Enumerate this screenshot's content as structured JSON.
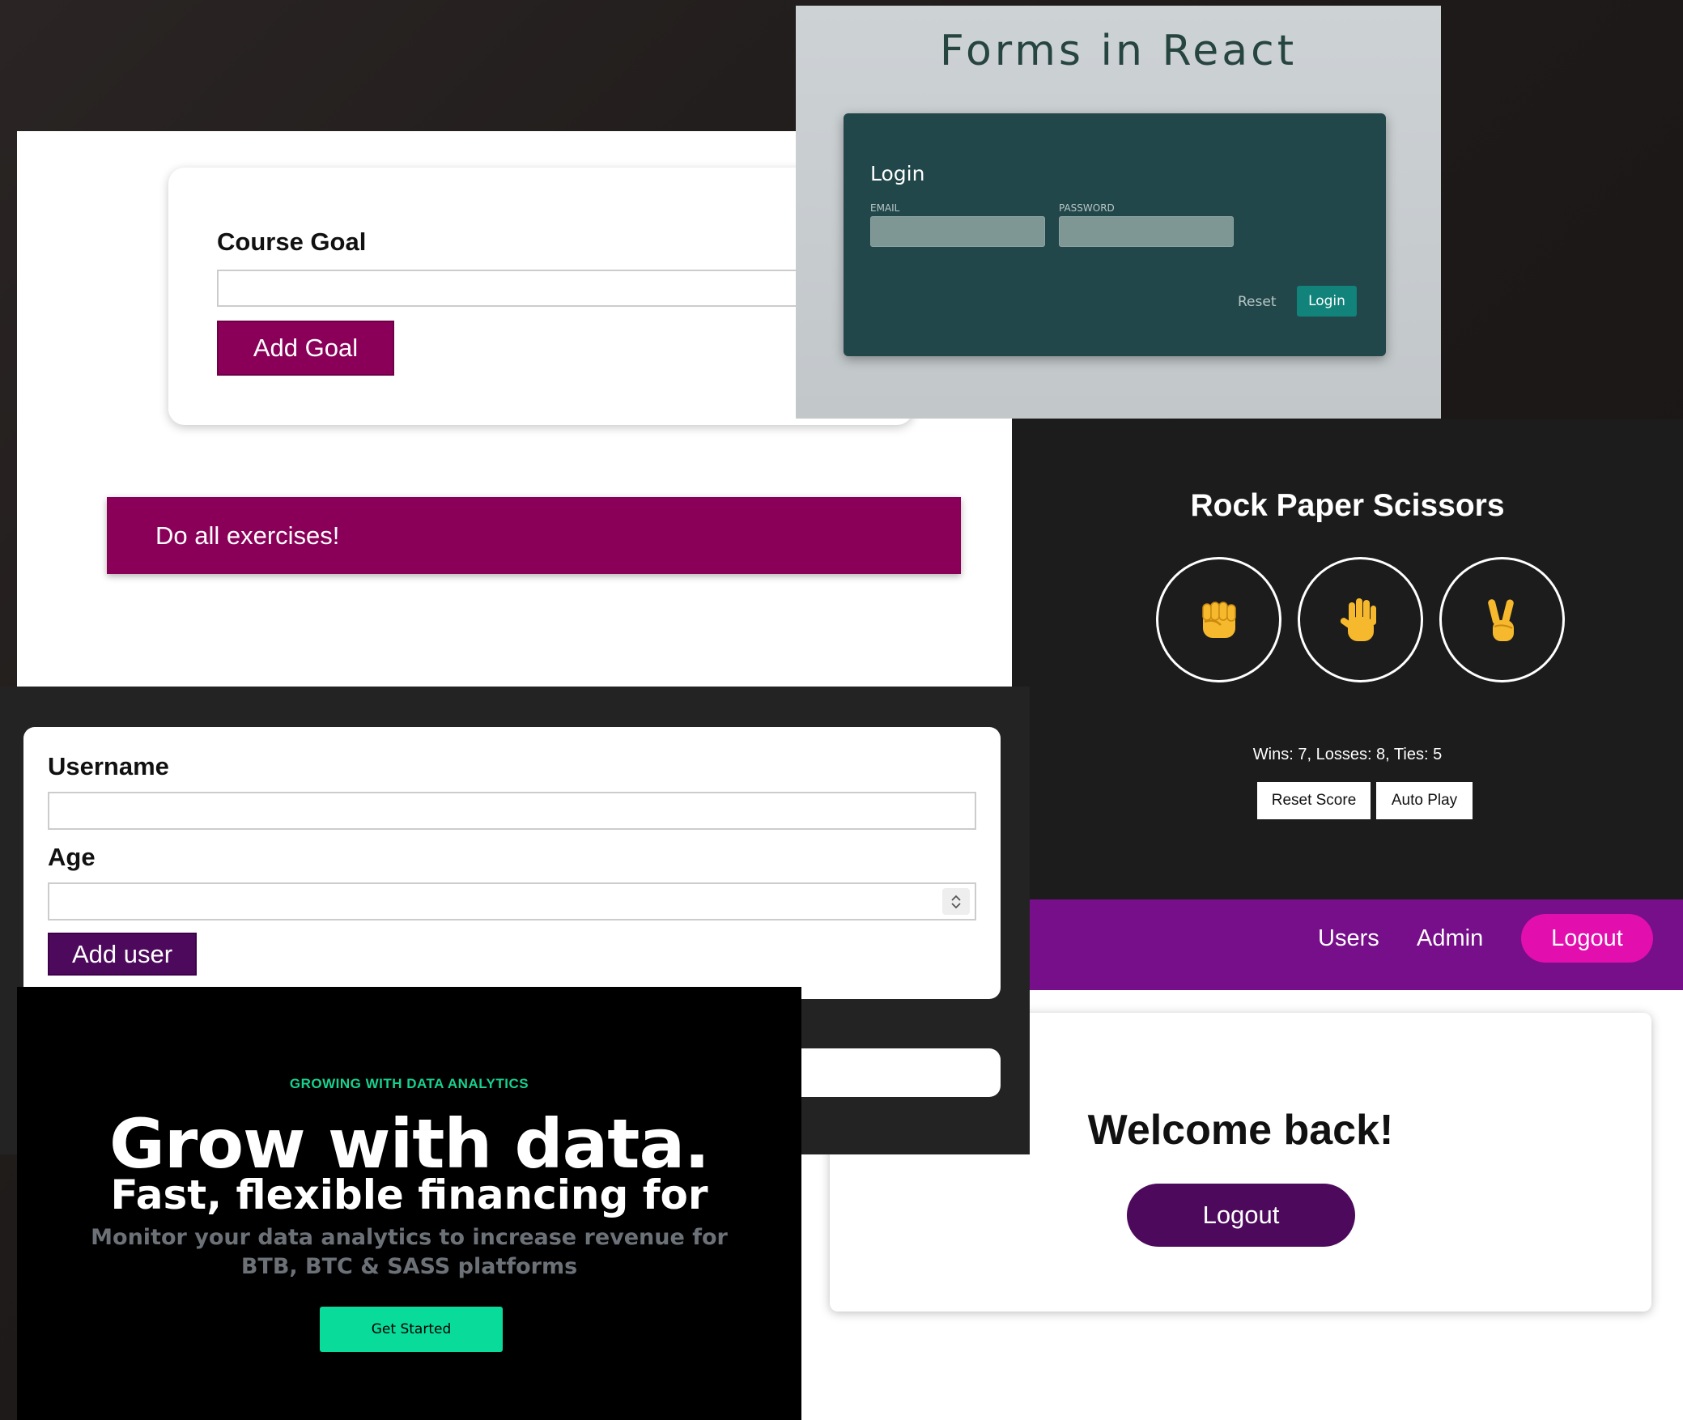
{
  "course_goal": {
    "label": "Course Goal",
    "input_value": "",
    "add_button": "Add Goal",
    "goal_item": "Do all exercises!"
  },
  "forms_react": {
    "title": "Forms in React",
    "card_title": "Login",
    "email_label": "EMAIL",
    "password_label": "PASSWORD",
    "reset_label": "Reset",
    "login_button": "Login"
  },
  "rps": {
    "title": "Rock Paper Scissors",
    "choices": [
      {
        "name": "rock-icon",
        "glyph": "✊"
      },
      {
        "name": "paper-icon",
        "glyph": "🖐"
      },
      {
        "name": "scissors-icon",
        "glyph": "✌"
      }
    ],
    "score": "Wins: 7, Losses: 8, Ties: 5",
    "reset_button": "Reset Score",
    "autoplay_button": "Auto Play"
  },
  "add_user": {
    "username_label": "Username",
    "age_label": "Age",
    "add_button": "Add user"
  },
  "auth": {
    "nav_users": "Users",
    "nav_admin": "Admin",
    "nav_logout": "Logout",
    "welcome": "Welcome back!",
    "logout_button": "Logout"
  },
  "data_analytics": {
    "eyebrow": "GROWING WITH DATA ANALYTICS",
    "title": "Grow with data.",
    "subtitle": "Fast, flexible financing for",
    "description": "Monitor your data analytics to increase revenue for BTB, BTC & SASS platforms",
    "cta": "Get Started"
  },
  "colors": {
    "goal_purple": "#8a0059",
    "login_teal": "#21474a",
    "login_button": "#11837b",
    "nav_purple": "#770e8a",
    "logout_pink": "#e20fae",
    "user_purple": "#4d0a5c",
    "data_green": "#09dc9a"
  }
}
